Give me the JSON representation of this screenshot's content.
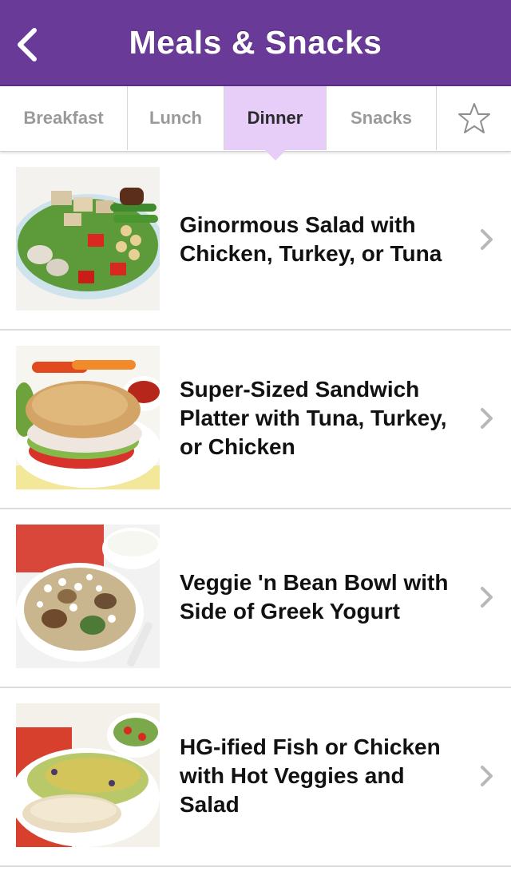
{
  "header": {
    "title": "Meals & Snacks",
    "back_icon": "chevron-left-icon"
  },
  "tabs": [
    {
      "label": "Breakfast",
      "active": false
    },
    {
      "label": "Lunch",
      "active": false
    },
    {
      "label": "Dinner",
      "active": true
    },
    {
      "label": "Snacks",
      "active": false
    }
  ],
  "favorites_icon": "star-outline-icon",
  "meals": [
    {
      "title": "Ginormous Salad with Chicken, Turkey, or Tuna",
      "image": "salad-photo"
    },
    {
      "title": "Super-Sized Sandwich Platter with Tuna, Turkey, or Chicken",
      "image": "sandwich-photo"
    },
    {
      "title": "Veggie 'n Bean Bowl with Side of Greek Yogurt",
      "image": "veggie-bowl-photo"
    },
    {
      "title": "HG-ified Fish or Chicken with Hot Veggies and Salad",
      "image": "fish-plate-photo"
    }
  ],
  "colors": {
    "header": "#6a3a99",
    "active_tab": "#e6cef8",
    "inactive_tab_text": "#9a9a9a",
    "chevron": "#b8b8b8"
  }
}
